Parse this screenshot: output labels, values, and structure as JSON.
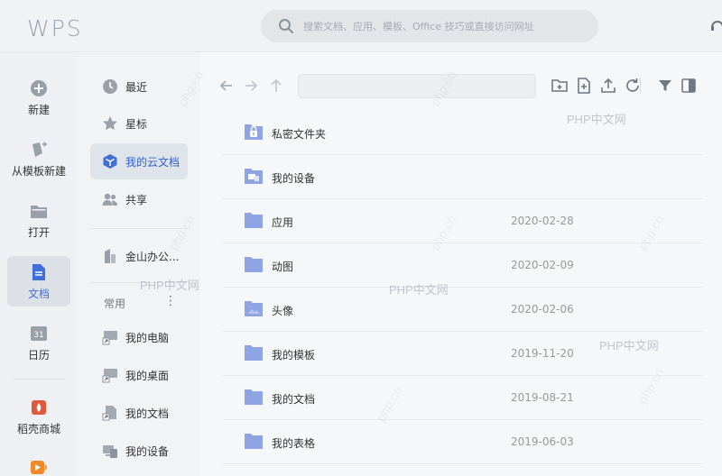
{
  "app": {
    "logo_text": "WPS",
    "search_placeholder": "搜索文档、应用、模板、Office 技巧或直接访问网址"
  },
  "left_nav": {
    "items": [
      {
        "label": "新建",
        "icon": "plus-circle-icon"
      },
      {
        "label": "从模板新建",
        "icon": "template-icon"
      },
      {
        "label": "打开",
        "icon": "folder-open-icon"
      },
      {
        "label": "文档",
        "icon": "document-icon",
        "active": true
      },
      {
        "label": "日历",
        "icon": "calendar-icon"
      },
      {
        "label": "稻壳商城",
        "icon": "docer-store-icon"
      }
    ]
  },
  "col2": {
    "items": [
      {
        "label": "最近",
        "icon": "clock-icon"
      },
      {
        "label": "星标",
        "icon": "star-icon"
      },
      {
        "label": "我的云文档",
        "icon": "cloud-docs-icon",
        "active": true
      },
      {
        "label": "共享",
        "icon": "share-users-icon"
      }
    ],
    "org_label": "金山办公...",
    "common_label": "常用",
    "more": "⋮",
    "shortcuts": [
      {
        "label": "我的电脑"
      },
      {
        "label": "我的桌面"
      },
      {
        "label": "我的文档"
      },
      {
        "label": "我的设备"
      }
    ]
  },
  "files": [
    {
      "name": "私密文件夹",
      "date": "",
      "icon": "locked-folder-icon"
    },
    {
      "name": "我的设备",
      "date": "",
      "icon": "device-folder-icon"
    },
    {
      "name": "应用",
      "date": "2020-02-28",
      "icon": "folder-icon"
    },
    {
      "name": "动图",
      "date": "2020-02-09",
      "icon": "folder-icon"
    },
    {
      "name": "头像",
      "date": "2020-02-06",
      "icon": "image-folder-icon"
    },
    {
      "name": "我的模板",
      "date": "2019-11-20",
      "icon": "folder-icon"
    },
    {
      "name": "我的文档",
      "date": "2019-08-21",
      "icon": "folder-icon"
    },
    {
      "name": "我的表格",
      "date": "2019-06-03",
      "icon": "folder-icon"
    }
  ],
  "watermark": "PHP中文网",
  "watermark_small": "php.cn",
  "colors": {
    "accent": "#3f6fd8",
    "folder": "#8ea4e3"
  }
}
